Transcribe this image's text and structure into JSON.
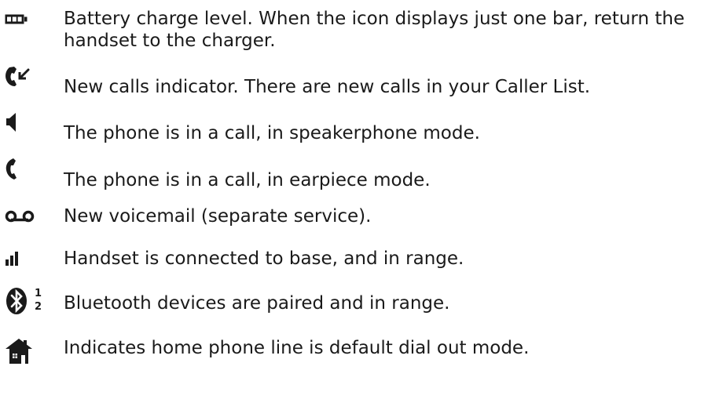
{
  "items": [
    {
      "icon": "battery-icon",
      "lines": [
        "Battery charge level. When the icon displays just one bar, return the",
        "handset to the charger."
      ]
    },
    {
      "icon": "new-calls-icon",
      "lines": [
        "New calls indicator. There are new calls in your Caller List."
      ]
    },
    {
      "icon": "speaker-icon",
      "lines": [
        "The phone is in a call, in speakerphone mode."
      ]
    },
    {
      "icon": "handset-icon",
      "lines": [
        "The phone is in a call, in earpiece mode."
      ]
    },
    {
      "icon": "voicemail-icon",
      "lines": [
        "New voicemail (separate service)."
      ]
    },
    {
      "icon": "signal-icon",
      "lines": [
        "Handset is connected to base, and in range."
      ]
    },
    {
      "icon": "bluetooth-icon",
      "badge_top": "1",
      "badge_bottom": "2",
      "lines": [
        "Bluetooth devices are paired and in range."
      ]
    },
    {
      "icon": "home-icon",
      "lines": [
        "Indicates home phone line is default dial out mode."
      ]
    }
  ]
}
